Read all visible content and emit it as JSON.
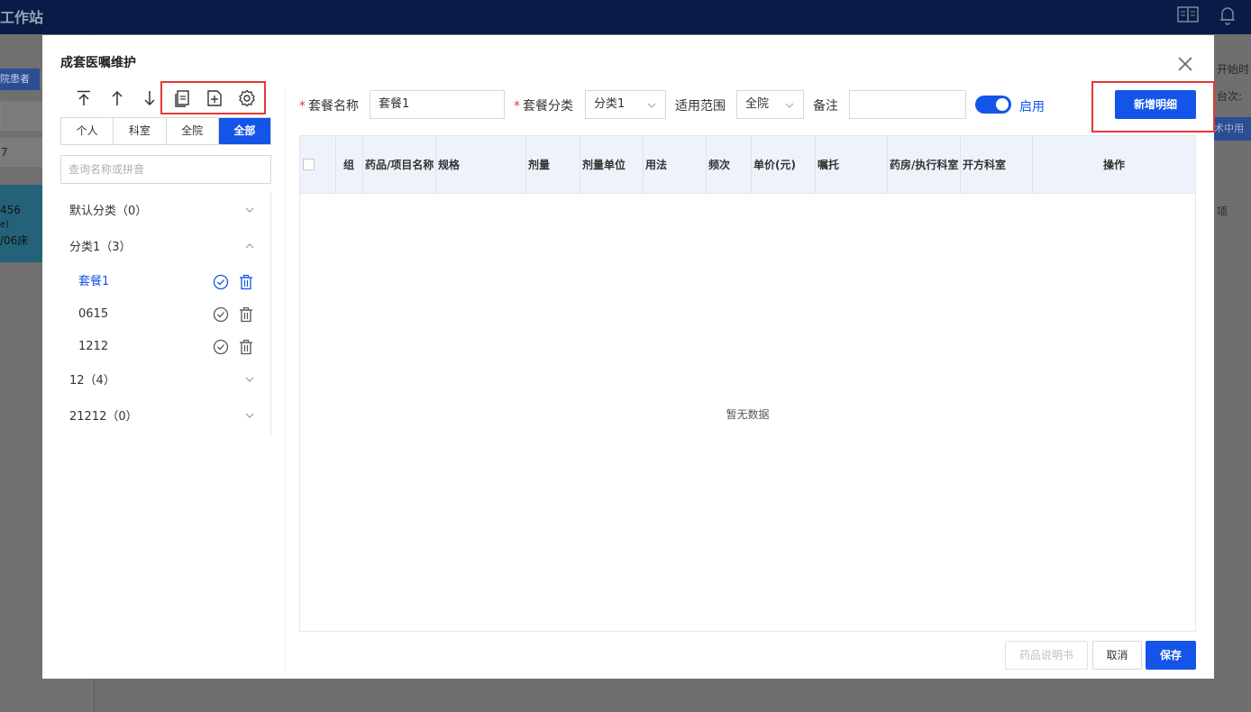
{
  "background": {
    "app_title": "工作站",
    "tag": "院患者",
    "box1": "",
    "box2": "7",
    "patient_line1": "456",
    "patient_line2": "e)",
    "patient_line3": "/06床",
    "right_text1": "开始时",
    "right_text2": "台次:",
    "right_tab": "术中用",
    "right_text3": "项"
  },
  "modal": {
    "title": "成套医嘱维护",
    "toolbar_icons": [
      "move-top-icon",
      "move-up-icon",
      "move-down-icon",
      "copy-icon",
      "add-file-icon",
      "settings-icon"
    ],
    "scope_tabs": [
      {
        "label": "个人",
        "active": false
      },
      {
        "label": "科室",
        "active": false
      },
      {
        "label": "全院",
        "active": false
      },
      {
        "label": "全部",
        "active": true
      }
    ],
    "search_placeholder": "查询名称或拼音",
    "categories": [
      {
        "label": "默认分类（0）",
        "expanded": false
      },
      {
        "label": "分类1（3）",
        "expanded": true
      },
      {
        "label": "12（4）",
        "expanded": false
      },
      {
        "label": "21212（0）",
        "expanded": false
      }
    ],
    "items": [
      {
        "label": "套餐1",
        "active": true
      },
      {
        "label": "0615",
        "active": false
      },
      {
        "label": "1212",
        "active": false
      }
    ],
    "form": {
      "name_label": "套餐名称",
      "name_value": "套餐1",
      "category_label": "套餐分类",
      "category_value": "分类1",
      "scope_label": "适用范围",
      "scope_value": "全院",
      "remark_label": "备注",
      "remark_value": "",
      "enable_label": "启用",
      "enabled": true
    },
    "add_detail_button": "新增明细",
    "table": {
      "columns": [
        "组",
        "药品/项目名称",
        "规格",
        "剂量",
        "剂量单位",
        "用法",
        "频次",
        "单价(元)",
        "嘱托",
        "药房/执行科室",
        "开方科室",
        "操作"
      ],
      "empty_text": "暂无数据"
    },
    "footer": {
      "manual_button": "药品说明书",
      "cancel_button": "取消",
      "save_button": "保存"
    },
    "accent_color": "#1454e8",
    "highlight_color": "#e53935"
  }
}
